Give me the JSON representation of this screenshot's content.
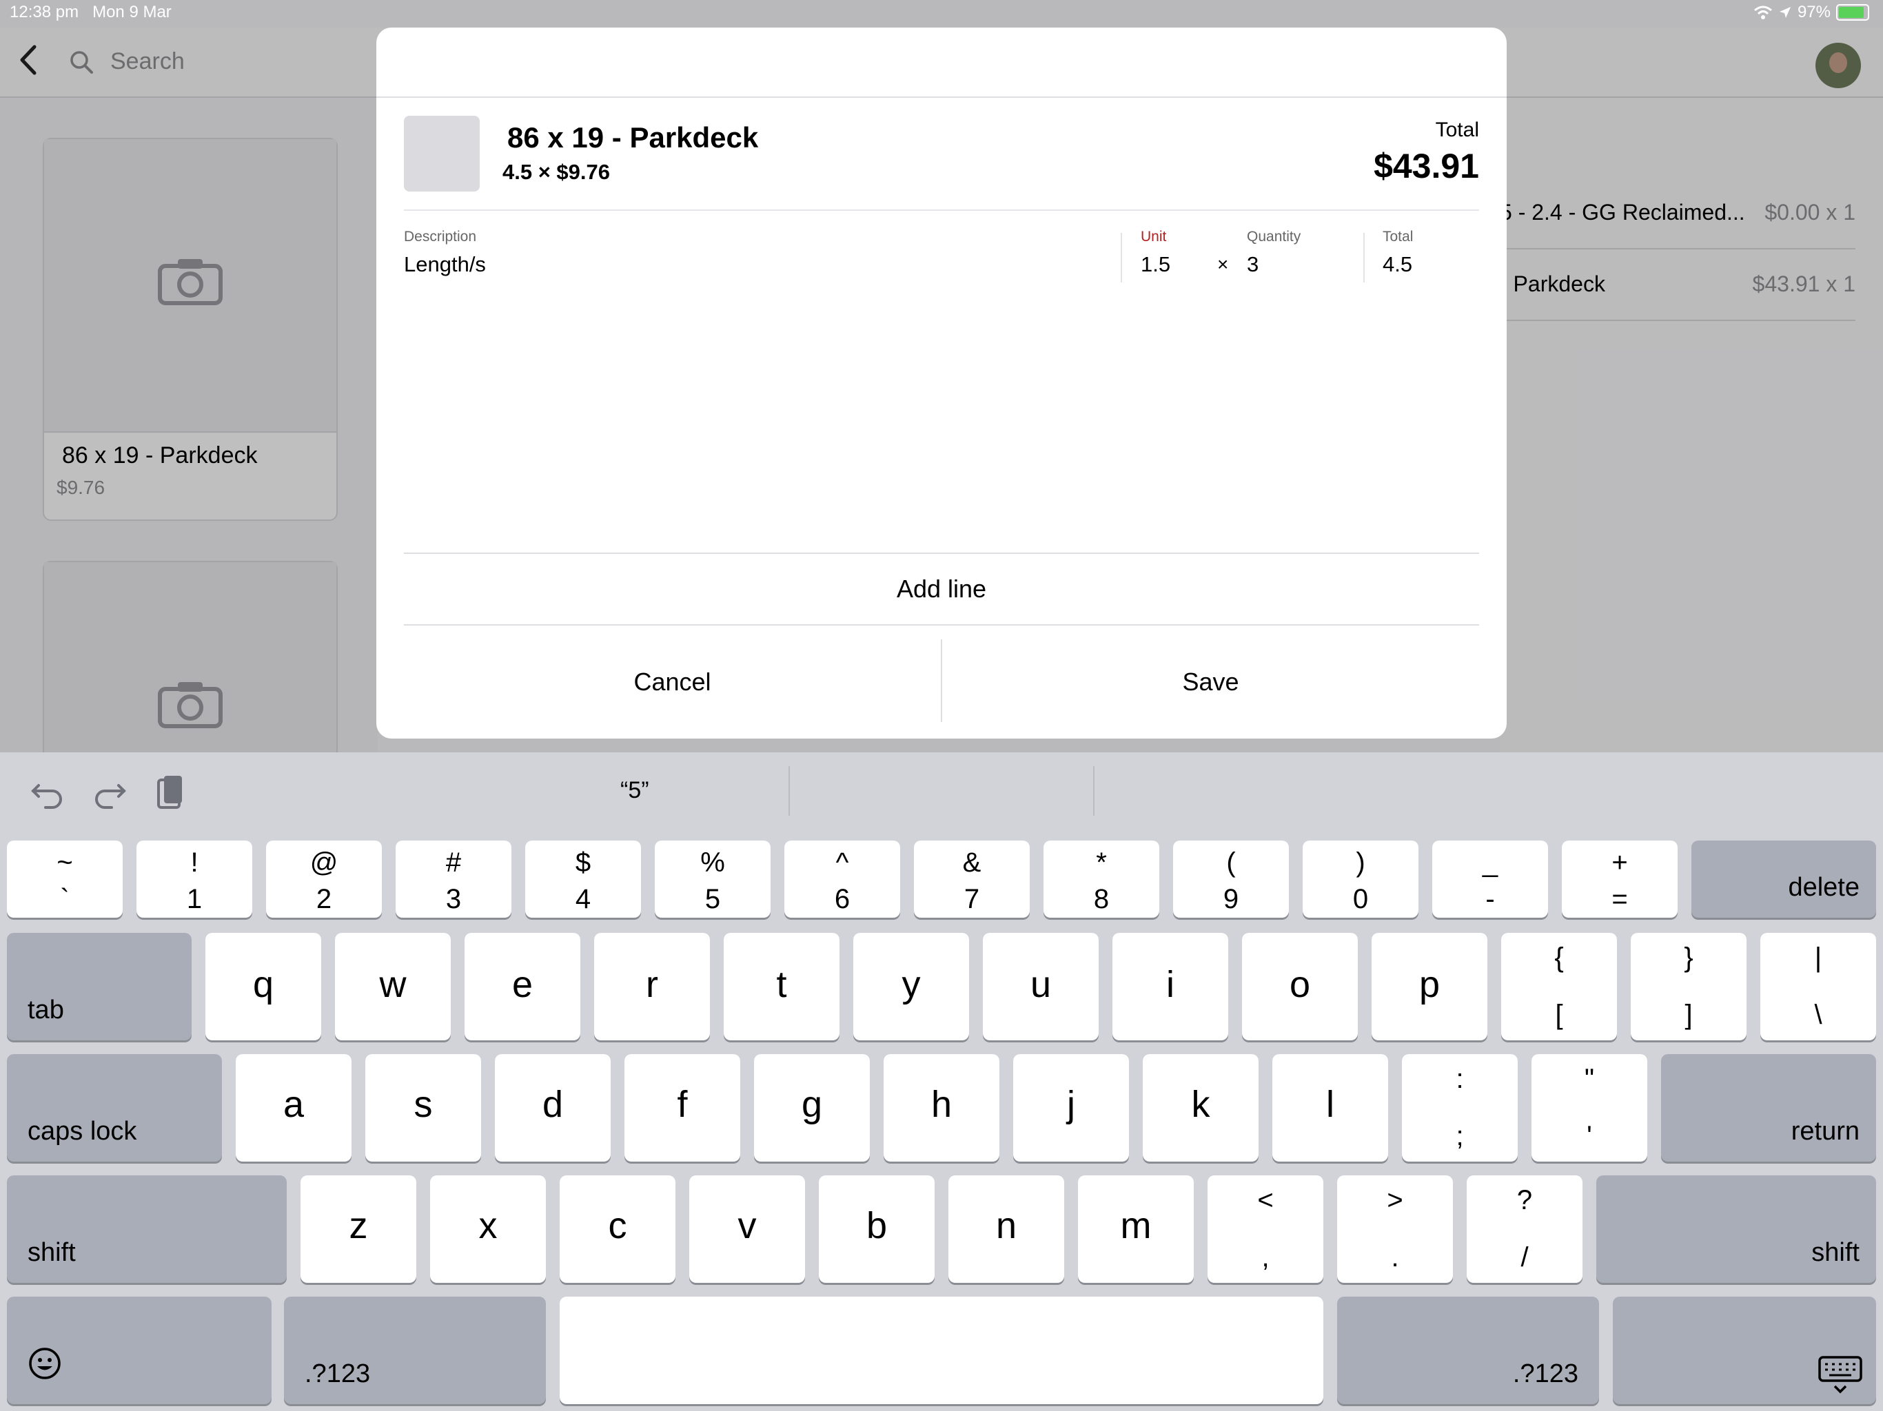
{
  "status_bar": {
    "time": "12:38 pm",
    "date": "Mon 9 Mar",
    "battery": "97%"
  },
  "topbar": {
    "search_placeholder": "Search"
  },
  "products": [
    {
      "title": "86 x 19 - Parkdeck",
      "price": "$9.76"
    }
  ],
  "cart": [
    {
      "name": "5 - 2.4 - GG Reclaimed...",
      "price": "$0.00 x 1"
    },
    {
      "name": "- Parkdeck",
      "price": "$43.91 x 1"
    }
  ],
  "modal": {
    "product_title": "86 x 19 - Parkdeck",
    "product_sub": "4.5 × $9.76",
    "total_label": "Total",
    "total_value": "$43.91",
    "columns": {
      "description": "Description",
      "unit": "Unit",
      "quantity": "Quantity",
      "total": "Total"
    },
    "line": {
      "description": "Length/s",
      "unit": "1.5",
      "times": "×",
      "quantity": "3",
      "total": "4.5"
    },
    "add_line": "Add line",
    "cancel": "Cancel",
    "save": "Save"
  },
  "keyboard": {
    "suggestion": "“5”",
    "number_row": [
      {
        "top": "~",
        "bottom": "`"
      },
      {
        "top": "!",
        "bottom": "1"
      },
      {
        "top": "@",
        "bottom": "2"
      },
      {
        "top": "#",
        "bottom": "3"
      },
      {
        "top": "$",
        "bottom": "4"
      },
      {
        "top": "%",
        "bottom": "5"
      },
      {
        "top": "^",
        "bottom": "6"
      },
      {
        "top": "&",
        "bottom": "7"
      },
      {
        "top": "*",
        "bottom": "8"
      },
      {
        "top": "(",
        "bottom": "9"
      },
      {
        "top": ")",
        "bottom": "0"
      },
      {
        "top": "_",
        "bottom": "-"
      },
      {
        "top": "+",
        "bottom": "="
      }
    ],
    "delete": "delete",
    "tab": "tab",
    "row_q": [
      "q",
      "w",
      "e",
      "r",
      "t",
      "y",
      "u",
      "i",
      "o",
      "p"
    ],
    "row_q_sym": [
      {
        "top": "{",
        "bottom": "["
      },
      {
        "top": "}",
        "bottom": "]"
      },
      {
        "top": "|",
        "bottom": "\\"
      }
    ],
    "caps": "caps lock",
    "row_a": [
      "a",
      "s",
      "d",
      "f",
      "g",
      "h",
      "j",
      "k",
      "l"
    ],
    "row_a_sym": [
      {
        "top": ":",
        "bottom": ";"
      },
      {
        "top": "\"",
        "bottom": "'"
      }
    ],
    "return": "return",
    "shift": "shift",
    "row_z": [
      "z",
      "x",
      "c",
      "v",
      "b",
      "n",
      "m"
    ],
    "row_z_sym": [
      {
        "top": "<",
        "bottom": ","
      },
      {
        "top": ">",
        "bottom": "."
      },
      {
        "top": "?",
        "bottom": "/"
      }
    ],
    "numbers": ".?123"
  }
}
